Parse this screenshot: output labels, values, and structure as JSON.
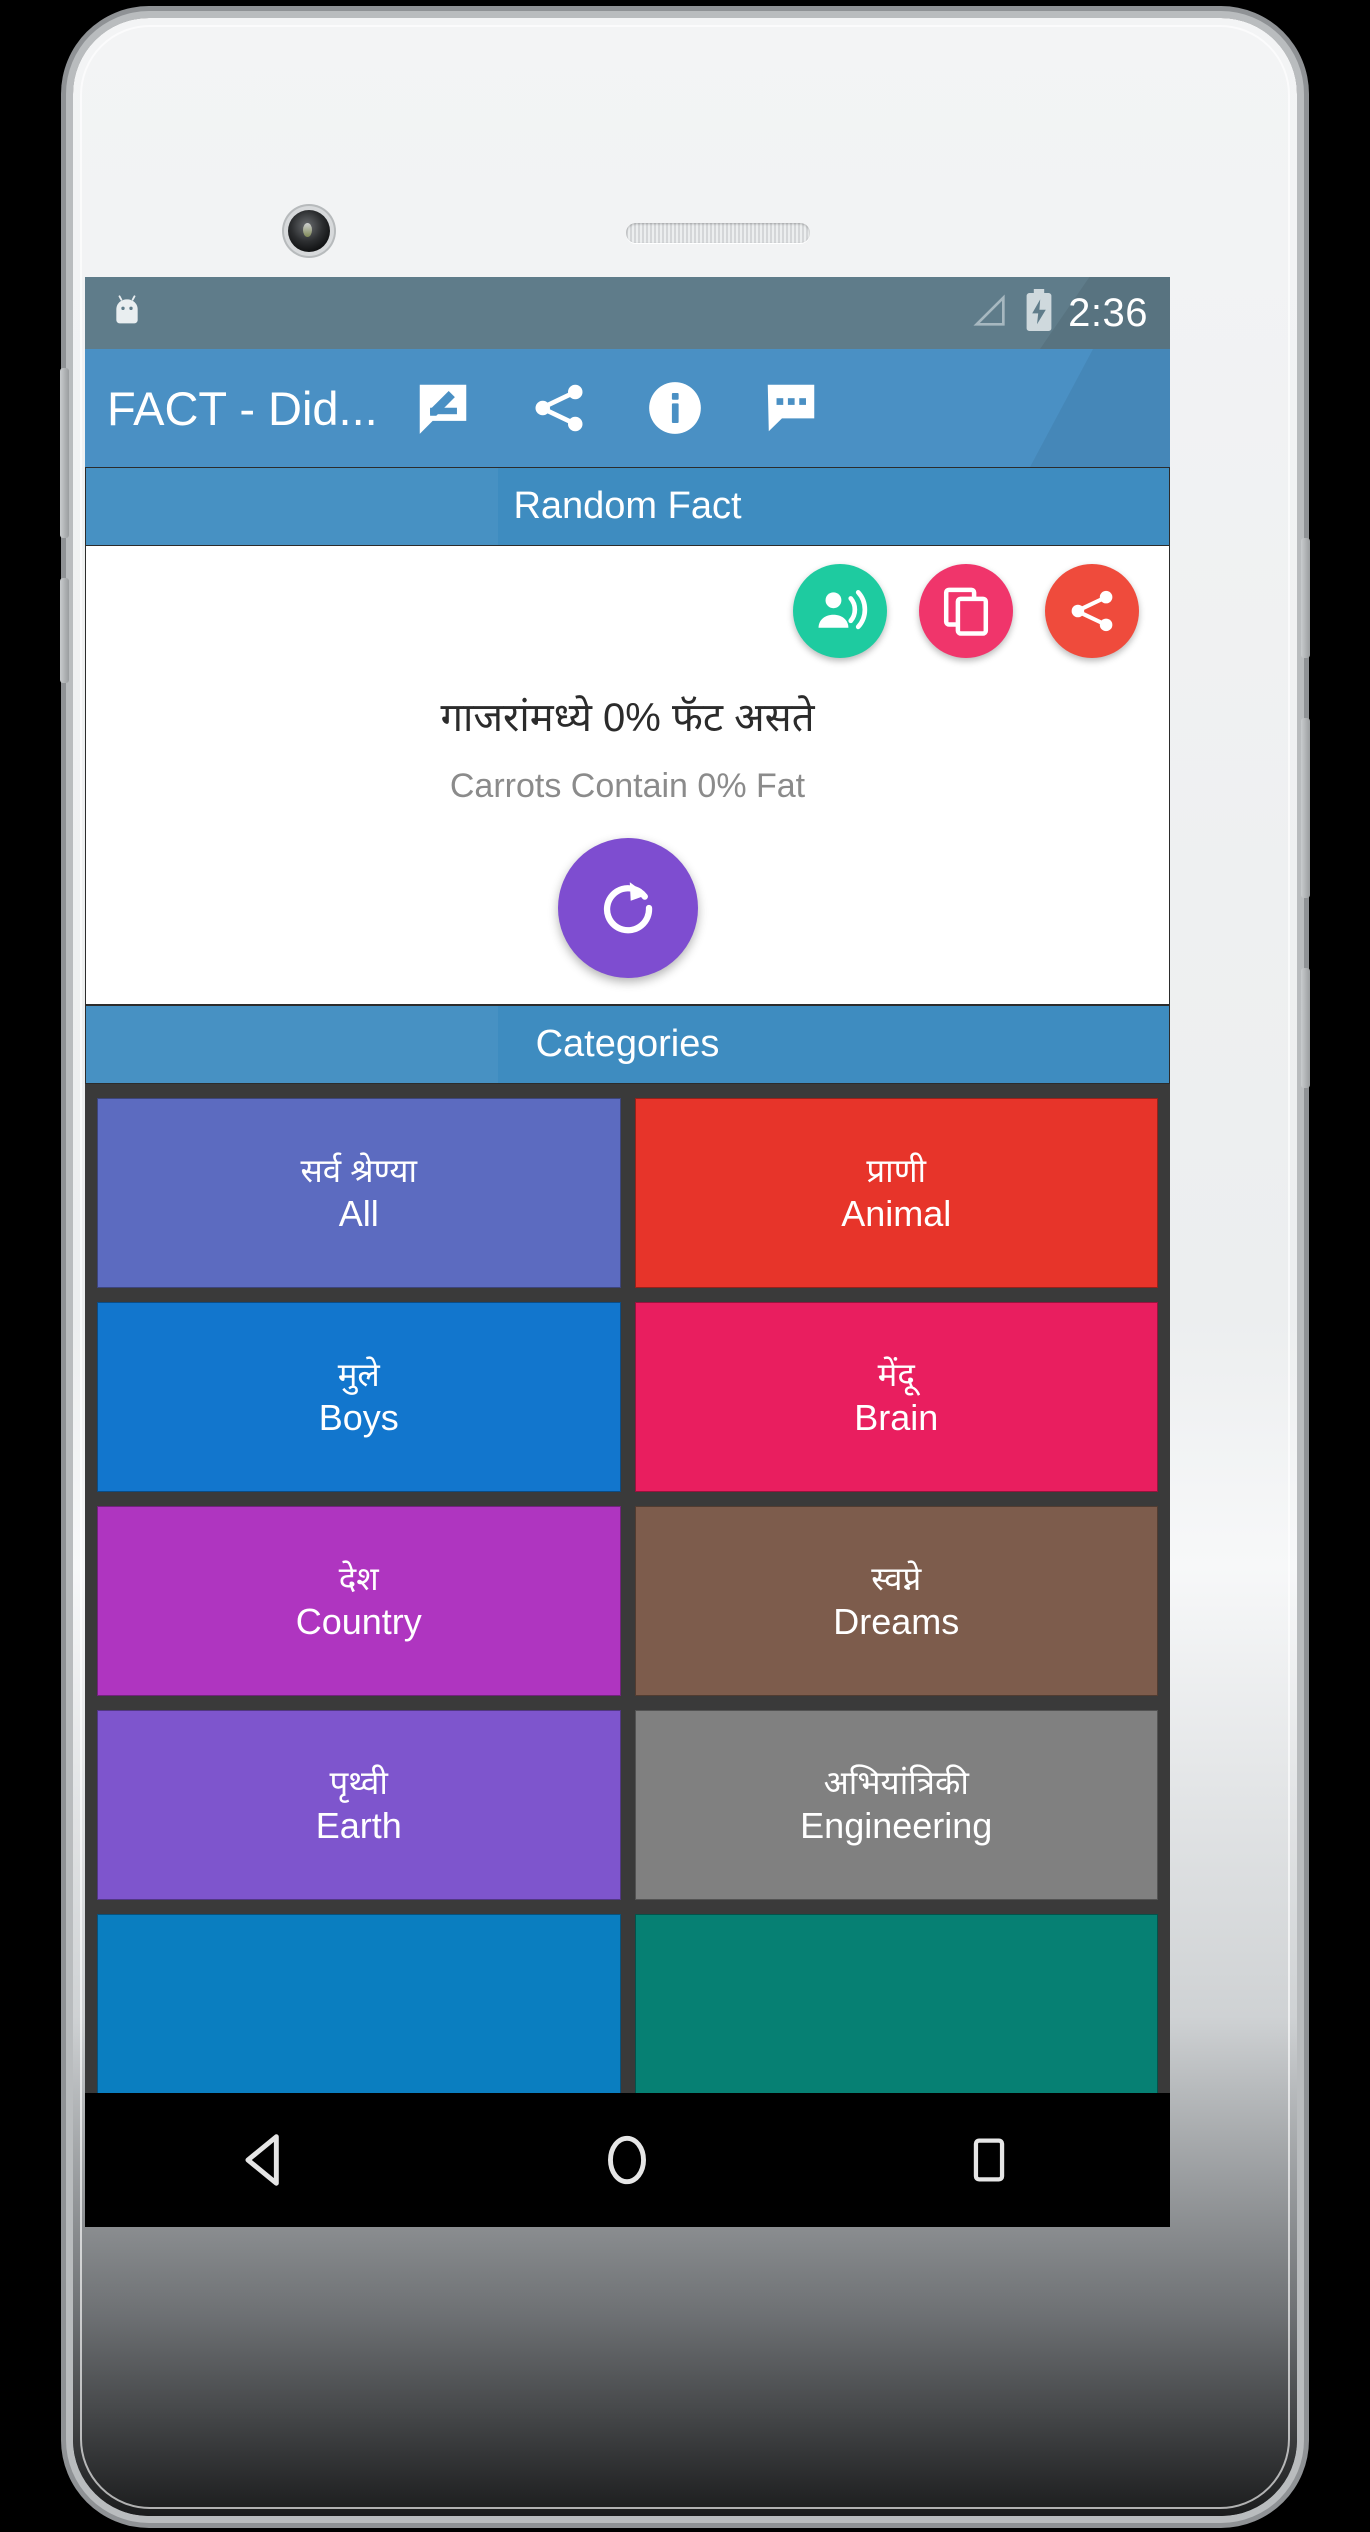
{
  "status_bar": {
    "time": "2:36",
    "icons": [
      "android-mascot-icon",
      "signal-icon",
      "battery-charging-icon"
    ],
    "bg": "#5f7c8a"
  },
  "app_bar": {
    "title": "FACT - Did...",
    "bg": "#4a90c4",
    "actions": [
      {
        "name": "rate-review-icon",
        "label": "Rate"
      },
      {
        "name": "share-icon",
        "label": "Share"
      },
      {
        "name": "info-icon",
        "label": "Info"
      },
      {
        "name": "feedback-icon",
        "label": "Feedback"
      }
    ]
  },
  "random_fact": {
    "header": "Random Fact",
    "native_text": "गाजरांमध्ये 0% फॅट असते",
    "english_text": "Carrots Contain 0% Fat",
    "actions": [
      {
        "name": "speak-icon",
        "label": "Speak",
        "color": "#1ecba0"
      },
      {
        "name": "copy-icon",
        "label": "Copy",
        "color": "#f0356b"
      },
      {
        "name": "share-icon",
        "label": "Share",
        "color": "#ef4b3c"
      }
    ],
    "refresh": {
      "name": "refresh-icon",
      "label": "Refresh",
      "color": "#7e4dd0"
    }
  },
  "categories": {
    "header": "Categories",
    "tiles": [
      {
        "native": "सर्व श्रेण्या",
        "english": "All",
        "color": "#5c6bc0"
      },
      {
        "native": "प्राणी",
        "english": "Animal",
        "color": "#e7342a"
      },
      {
        "native": "मुले",
        "english": "Boys",
        "color": "#1276cd"
      },
      {
        "native": "मेंदू",
        "english": "Brain",
        "color": "#e91e5f"
      },
      {
        "native": "देश",
        "english": "Country",
        "color": "#af35c0"
      },
      {
        "native": "स्वप्ने",
        "english": "Dreams",
        "color": "#7d5c4c"
      },
      {
        "native": "पृथ्वी",
        "english": "Earth",
        "color": "#7e55cd"
      },
      {
        "native": "अभियांत्रिकी",
        "english": "Engineering",
        "color": "#808080"
      },
      {
        "native": "",
        "english": "",
        "color": "#0a7ec0"
      },
      {
        "native": "",
        "english": "",
        "color": "#068073"
      }
    ]
  },
  "nav_bar": {
    "buttons": [
      {
        "name": "back-button",
        "label": "Back"
      },
      {
        "name": "home-button",
        "label": "Home"
      },
      {
        "name": "recents-button",
        "label": "Recents"
      }
    ]
  }
}
